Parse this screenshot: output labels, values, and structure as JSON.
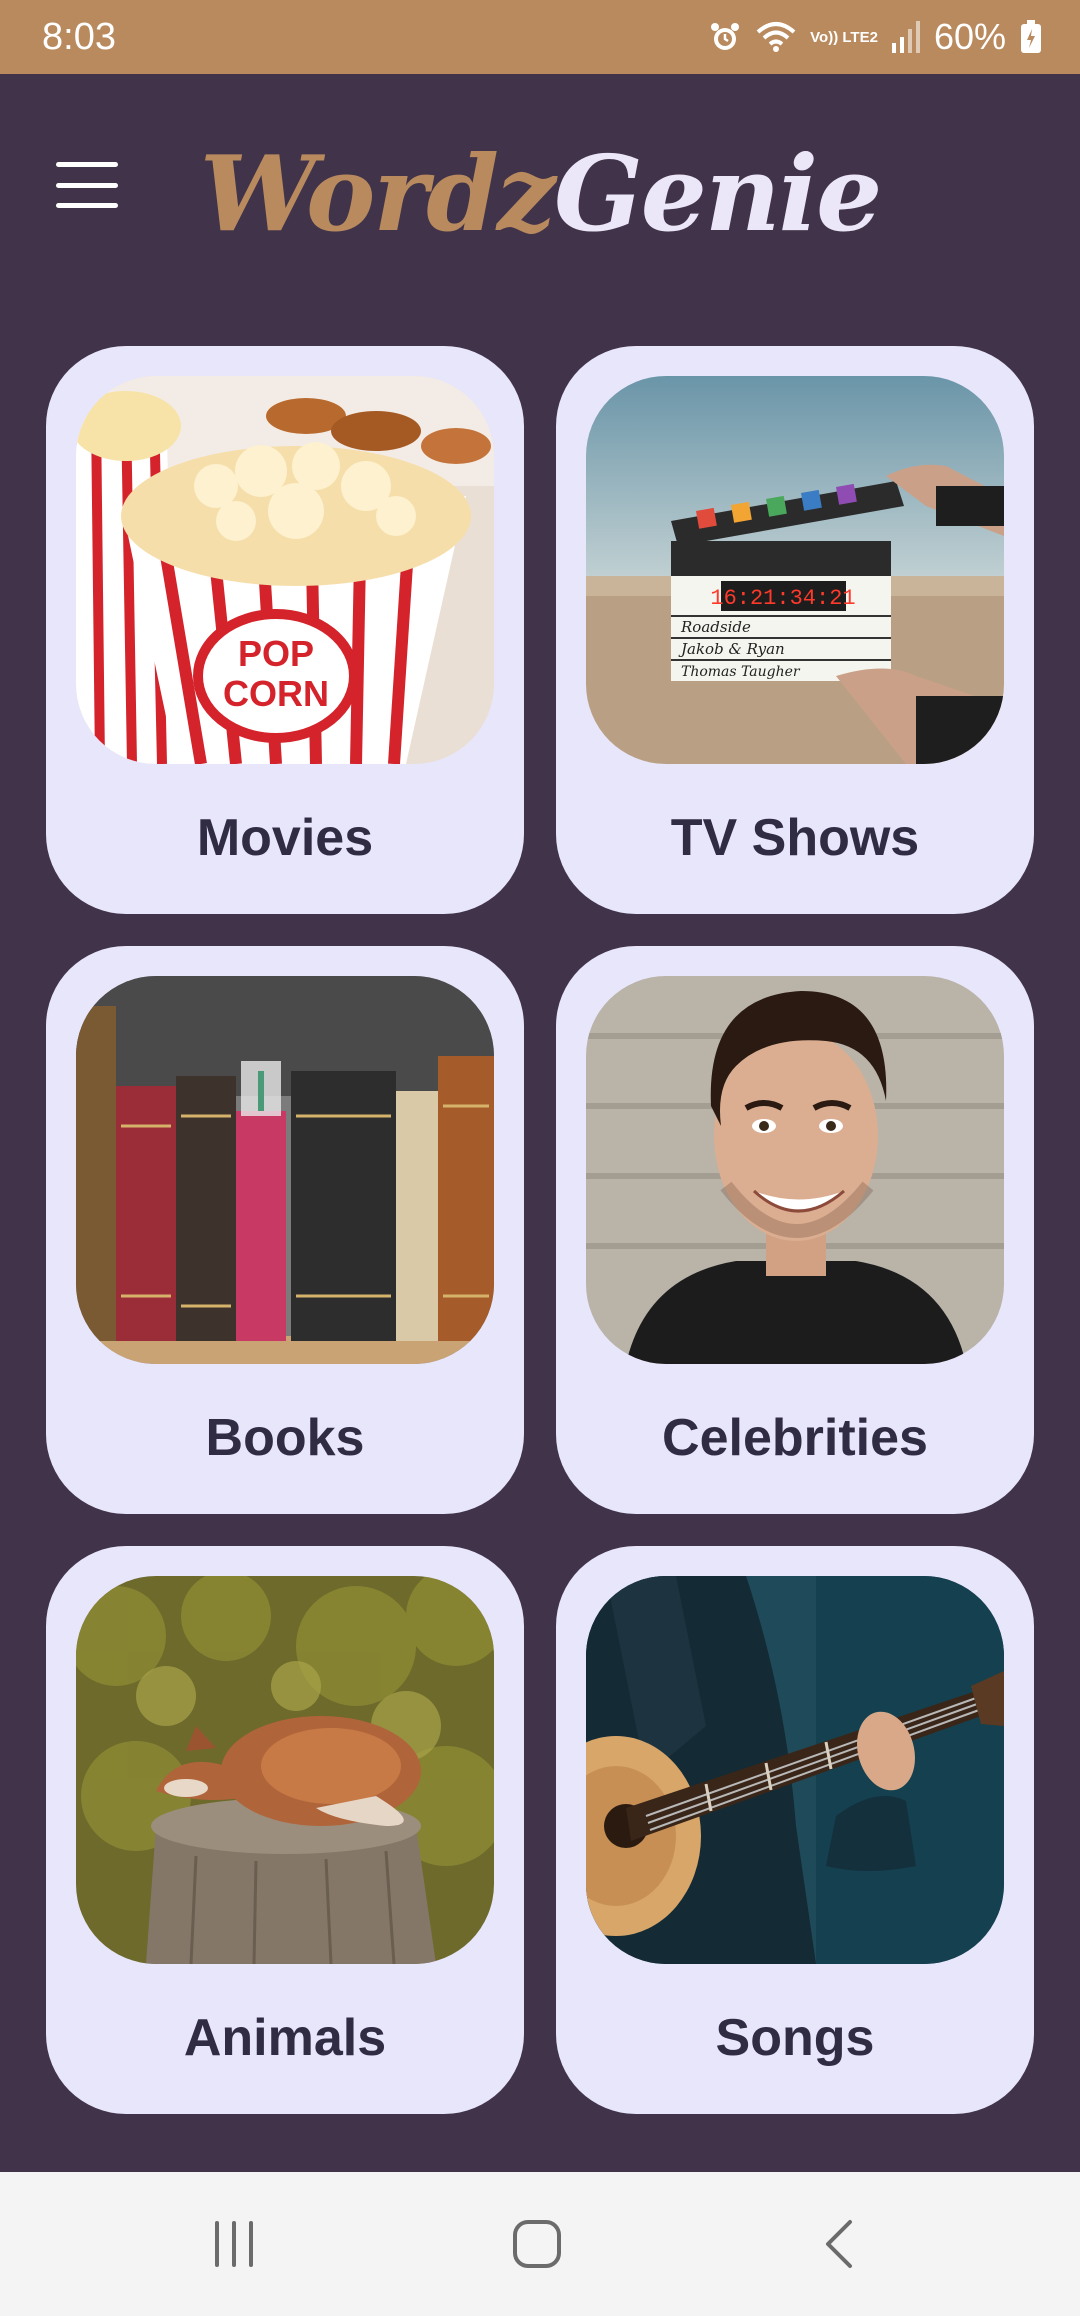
{
  "status_bar": {
    "time": "8:03",
    "network": "Vo)) LTE2",
    "battery": "60%",
    "icons": [
      "alarm-icon",
      "wifi-icon",
      "signal-icon",
      "battery-icon"
    ]
  },
  "header": {
    "menu_icon": "hamburger-menu-icon",
    "logo_part1": "Wordz",
    "logo_part2": "Genie"
  },
  "categories": [
    {
      "label": "Movies",
      "image": "popcorn-photo"
    },
    {
      "label": "TV Shows",
      "image": "clapperboard-photo"
    },
    {
      "label": "Books",
      "image": "old-books-photo"
    },
    {
      "label": "Celebrities",
      "image": "smiling-man-photo"
    },
    {
      "label": "Animals",
      "image": "sleeping-fox-photo"
    },
    {
      "label": "Songs",
      "image": "guitar-player-photo"
    }
  ],
  "nav_bar": {
    "recents_icon": "recent-apps-icon",
    "home_icon": "home-icon",
    "back_icon": "back-icon"
  },
  "colors": {
    "background": "#41344a",
    "status_bar": "#b98a5e",
    "card": "#e8e6fb",
    "card_text": "#302c44",
    "logo_accent": "#b98a5e",
    "logo_light": "#ebe6f8"
  }
}
